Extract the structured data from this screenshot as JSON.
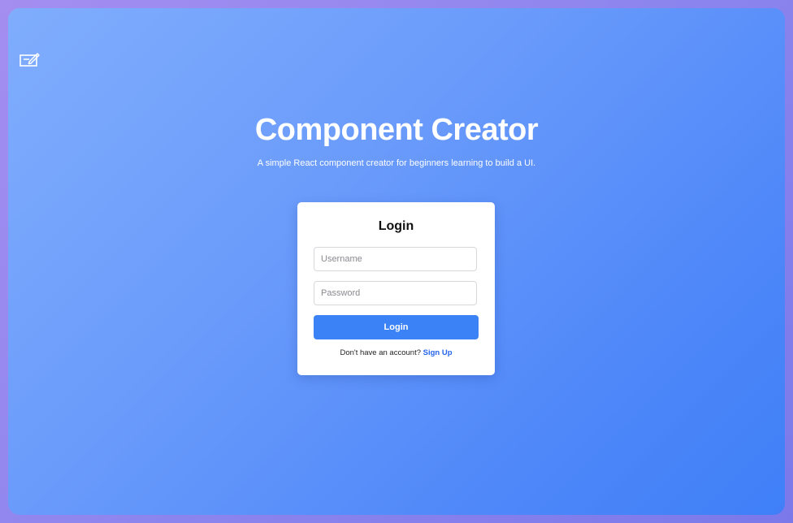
{
  "app": {
    "icon": "edit-note-icon",
    "title": "Component Creator",
    "subtitle": "A simple React component creator for beginners learning to build a UI."
  },
  "login": {
    "heading": "Login",
    "username_placeholder": "Username",
    "username_value": "",
    "password_placeholder": "Password",
    "password_value": "",
    "button_label": "Login",
    "signup_prompt": "Don't have an account?",
    "signup_link": "Sign Up"
  },
  "colors": {
    "background_start": "#80adfc",
    "background_end": "#3f7ff8",
    "outer_border": "#8d85ee",
    "button": "#3b82f6",
    "link": "#2563eb"
  }
}
